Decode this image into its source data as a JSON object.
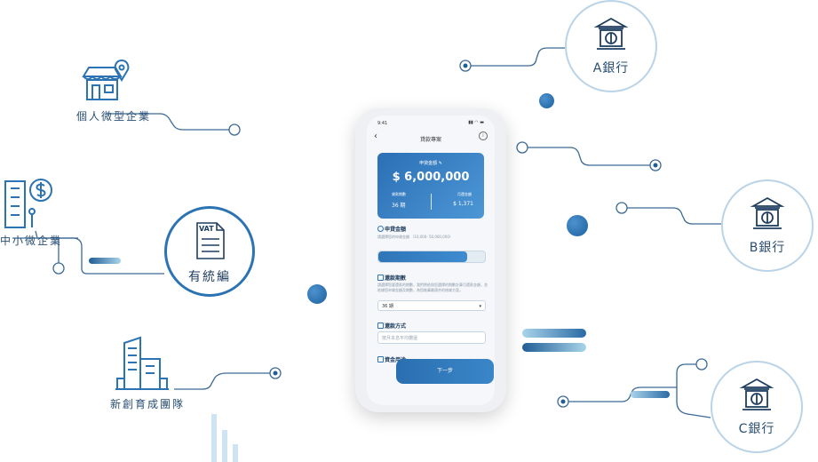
{
  "entities": {
    "personal_micro": "個人微型企業",
    "sme": "中小微企業",
    "startup": "新創育成團隊"
  },
  "vat": {
    "badge": "VAT",
    "caption": "有統編"
  },
  "banks": [
    {
      "name": "A銀行"
    },
    {
      "name": "B銀行"
    },
    {
      "name": "C銀行"
    }
  ],
  "icons": {
    "store": "storefront-location-icon",
    "building_dollar": "building-dollar-icon",
    "office": "office-buildings-icon",
    "vat_document": "vat-document-icon",
    "bank": "bank-dollar-icon"
  },
  "colors": {
    "accent": "#2b73b3",
    "line": "#3a6a97",
    "bank_ring": "#b9d3e8",
    "light_bar": "#8fc3de"
  },
  "phone": {
    "status_time": "9:41",
    "status_right": "▮▮ ◠ ▬",
    "nav_back": "‹",
    "title": "貸款專案",
    "info": "i",
    "summary": {
      "label": "申貸金額 ✎",
      "amount": "$ 6,000,000",
      "periods_label": "貸款期數",
      "periods_value": "36 期",
      "monthly_label": "月還金額",
      "monthly_value": "$ 1,371"
    },
    "loan_section": "申貸金額",
    "loan_hint": "請選擇您的申貸金額 （10,000- 50,000,000）",
    "slider_fill": 0.83,
    "repay_section": "還款期數",
    "repay_hint": "請選擇您要還款的期數，我們將依照您選擇的期數計算月還款金額，並依據您申貸金額及期數，為您推薦最適合的借貸方案。",
    "select_value": "36 期",
    "select_chev": "▾",
    "method_section": "還款方式",
    "method_placeholder": "按月本息平均攤還",
    "purpose_section": "資金用途",
    "next_button": "下一步"
  }
}
